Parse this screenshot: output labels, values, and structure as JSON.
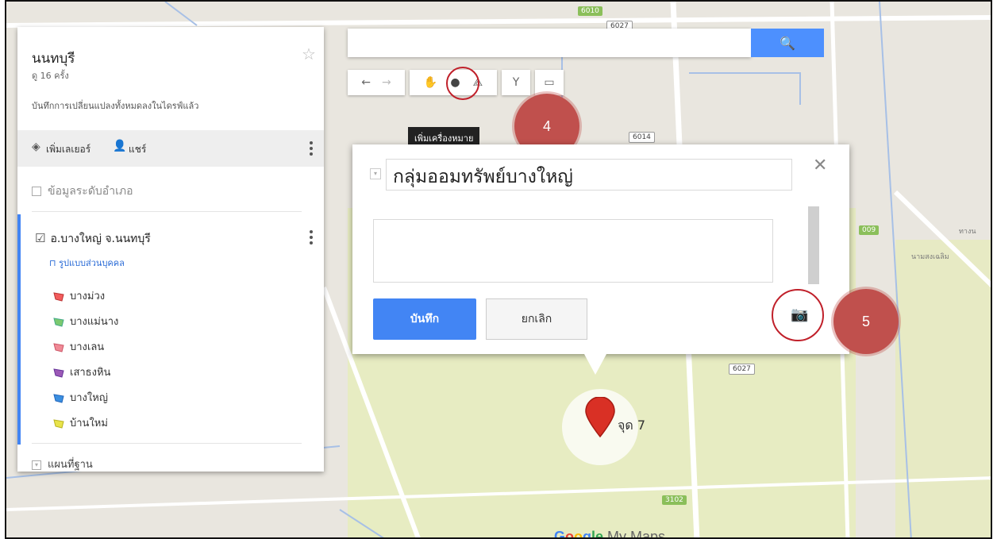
{
  "map": {
    "road_labels": [
      "6010",
      "6027",
      "6014",
      "6027",
      "3102",
      "009",
      "ทางน",
      "นามสงเฉลิม"
    ],
    "marker_label": "จุด 7",
    "logo": {
      "g": "G",
      "o1": "o",
      "o2": "o",
      "g2": "g",
      "l": "le",
      "rest": " My Maps"
    }
  },
  "panel": {
    "title": "นนทบุรี",
    "views": "ดู 16 ครั้ง",
    "saved": "บันทึกการเปลี่ยนแปลงทั้งหมดลงในไดรฟ์แล้ว",
    "add_layer": "เพิ่มเลเยอร์",
    "share": "แชร์",
    "layer1": "ข้อมูลระดับอำเภอ",
    "layer2": "อ.บางใหญ่ จ.นนทบุรี",
    "style": "รูปแบบส่วนบุคคล",
    "items": [
      {
        "label": "บางม่วง",
        "color": "#f25c5c"
      },
      {
        "label": "บางแม่นาง",
        "color": "#7bc96f"
      },
      {
        "label": "บางเลน",
        "color": "#f08a96"
      },
      {
        "label": "เสาธงหิน",
        "color": "#9b59b6"
      },
      {
        "label": "บางใหญ่",
        "color": "#3b8fe0"
      },
      {
        "label": "บ้านใหม่",
        "color": "#e8e34a"
      }
    ],
    "basemap": "แผนที่ฐาน"
  },
  "tooltip": "เพิ่มเครื่องหมาย",
  "callouts": [
    "4",
    "5"
  ],
  "infowindow": {
    "title": "กลุ่มออมทรัพย์บางใหญ่",
    "save": "บันทึก",
    "cancel": "ยกเลิก"
  }
}
